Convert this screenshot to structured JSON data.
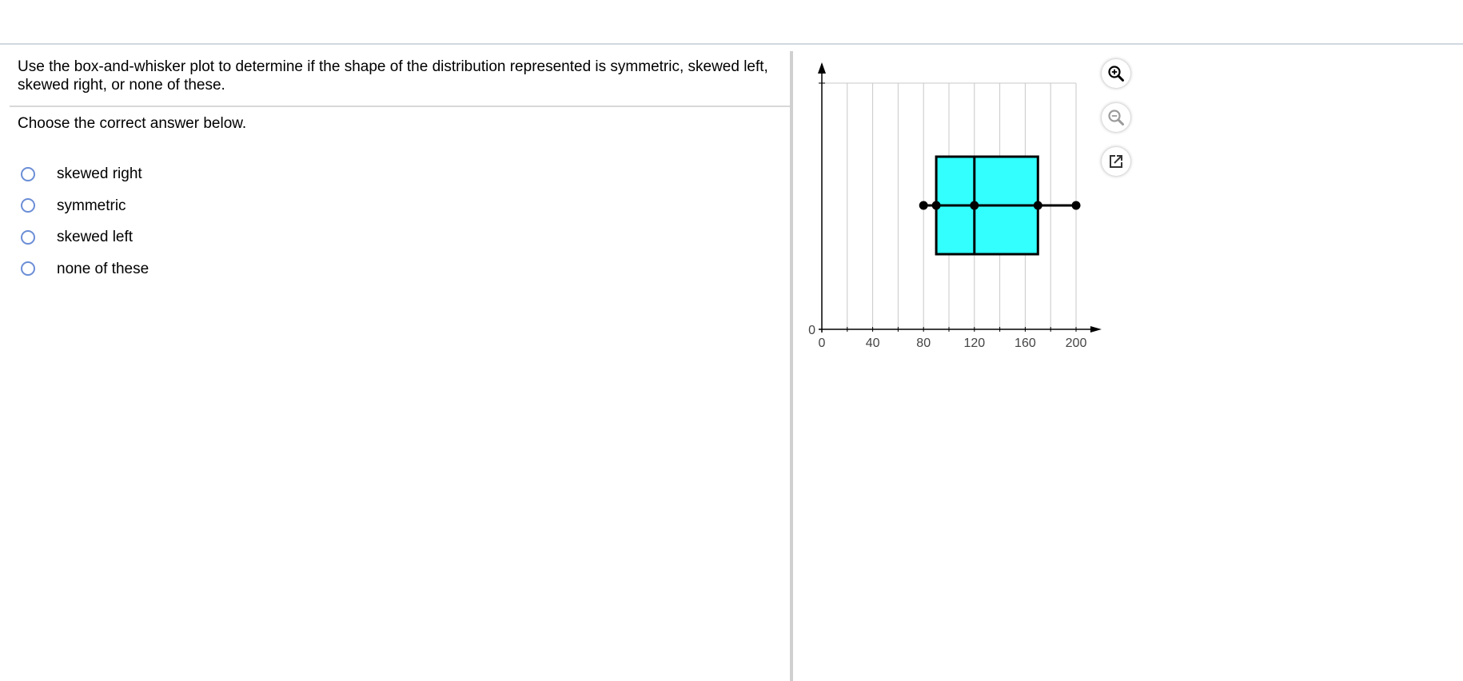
{
  "question": {
    "text": "Use the box-and-whisker plot to determine if the shape of the distribution represented is symmetric, skewed left, skewed right, or none of these.",
    "instruction": "Choose the correct answer below.",
    "options": [
      {
        "label": "skewed right",
        "selected": false
      },
      {
        "label": "symmetric",
        "selected": false
      },
      {
        "label": "skewed left",
        "selected": false
      },
      {
        "label": "none of these",
        "selected": false
      }
    ]
  },
  "tools": [
    {
      "icon": "zoom-in-icon"
    },
    {
      "icon": "zoom-out-icon"
    },
    {
      "icon": "popout-icon"
    }
  ],
  "colors": {
    "box_fill": "#33ffff",
    "radio_border": "#6b8ed6",
    "gridline": "#c8c8c8",
    "divider": "#d0d0d0"
  },
  "chart_data": {
    "type": "boxplot",
    "title": "",
    "xlabel": "",
    "ylabel": "",
    "xlim": [
      0,
      210
    ],
    "x_ticks": [
      0,
      40,
      80,
      120,
      160,
      200
    ],
    "y_tick_labels": [
      "0"
    ],
    "grid": true,
    "box": {
      "min": 80,
      "q1": 90,
      "median": 120,
      "q3": 170,
      "max": 200
    }
  }
}
